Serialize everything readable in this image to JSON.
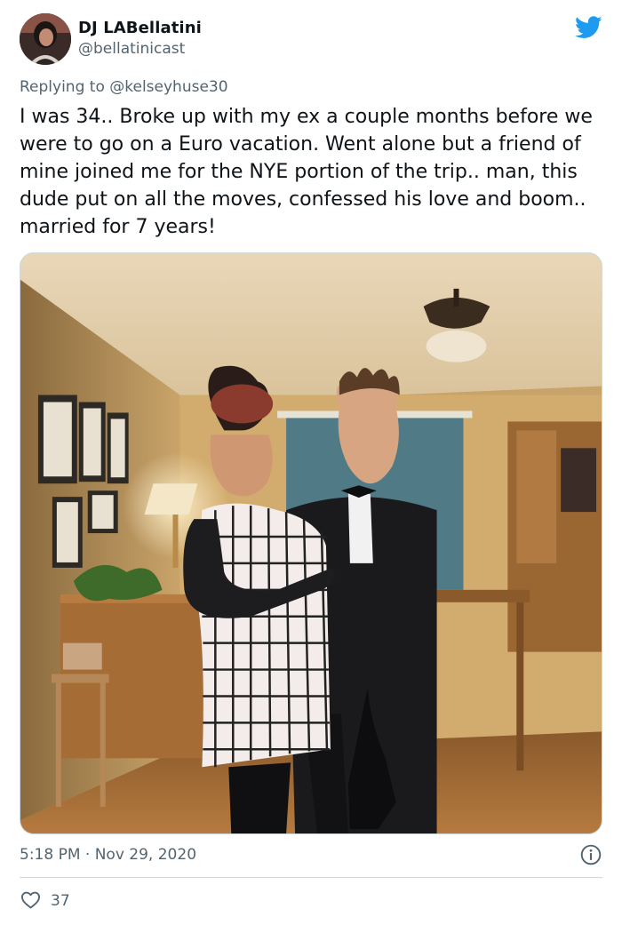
{
  "author": {
    "display_name": "DJ LABellatini",
    "handle": "@bellatinicast"
  },
  "reply_context": {
    "prefix": "Replying to ",
    "mention": "@kelseyhuse30"
  },
  "tweet": {
    "text": "I was 34.. Broke up with my ex a couple months before we were to go on a Euro vacation. Went alone but a friend of mine joined me for the NYE portion of the trip.. man, this dude put on all the moves, confessed his love and boom.. married for 7 years!",
    "time": "5:18 PM",
    "separator": " · ",
    "date": "Nov 29, 2020"
  },
  "stats": {
    "likes": "37"
  },
  "icons": {
    "brand": "twitter-bird-icon",
    "info": "info-icon",
    "like": "heart-icon"
  },
  "colors": {
    "twitter_blue": "#1d9bf0",
    "secondary_text": "#536471",
    "primary_text": "#0f1419",
    "divider": "#cfd9de"
  }
}
